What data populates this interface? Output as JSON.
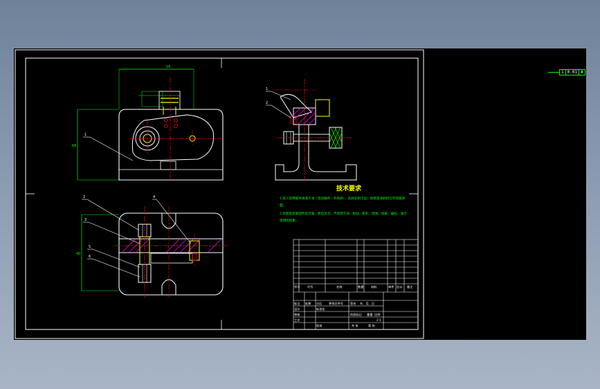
{
  "colors": {
    "background": "#000000",
    "outline": "#ffffff",
    "dimension": "#00ff00",
    "centerline": "#ff0000",
    "hatch": "#ff00ff",
    "heading": "#ffff00"
  },
  "tech_notes": {
    "title": "技术要求",
    "lines": [
      "1.装入前零部件清洗干净（包括铸件、外购件），去除毛刺飞边，防锈漆涂刷均匀不得漏涂",
      "面。",
      "2.装配后各紧固件应可靠，转动灵活，不得有卡滞、松动、变形、锈蚀、划痕、磕伤、油污",
      "等缺陷现象。"
    ]
  },
  "balloons": {
    "top_view": [
      "1"
    ],
    "bottom_view": [
      "2",
      "3",
      "4",
      "5",
      "6"
    ],
    "side_view": [
      "1",
      "2"
    ]
  },
  "gdt_tag": [
    "1",
    "0.01",
    "A"
  ],
  "title_block": {
    "header": [
      "序号",
      "代号",
      "名称",
      "数量",
      "材料",
      "单件",
      "总计",
      "备注"
    ],
    "labels": [
      "标记",
      "处数",
      "分区",
      "更改文件号",
      "签名",
      "年、月、日",
      "设计",
      "标准化",
      "审核",
      "工艺",
      "批准",
      "阶段标记",
      "重量",
      "比例",
      "共 张",
      "第 张"
    ],
    "scale": "2:1"
  }
}
